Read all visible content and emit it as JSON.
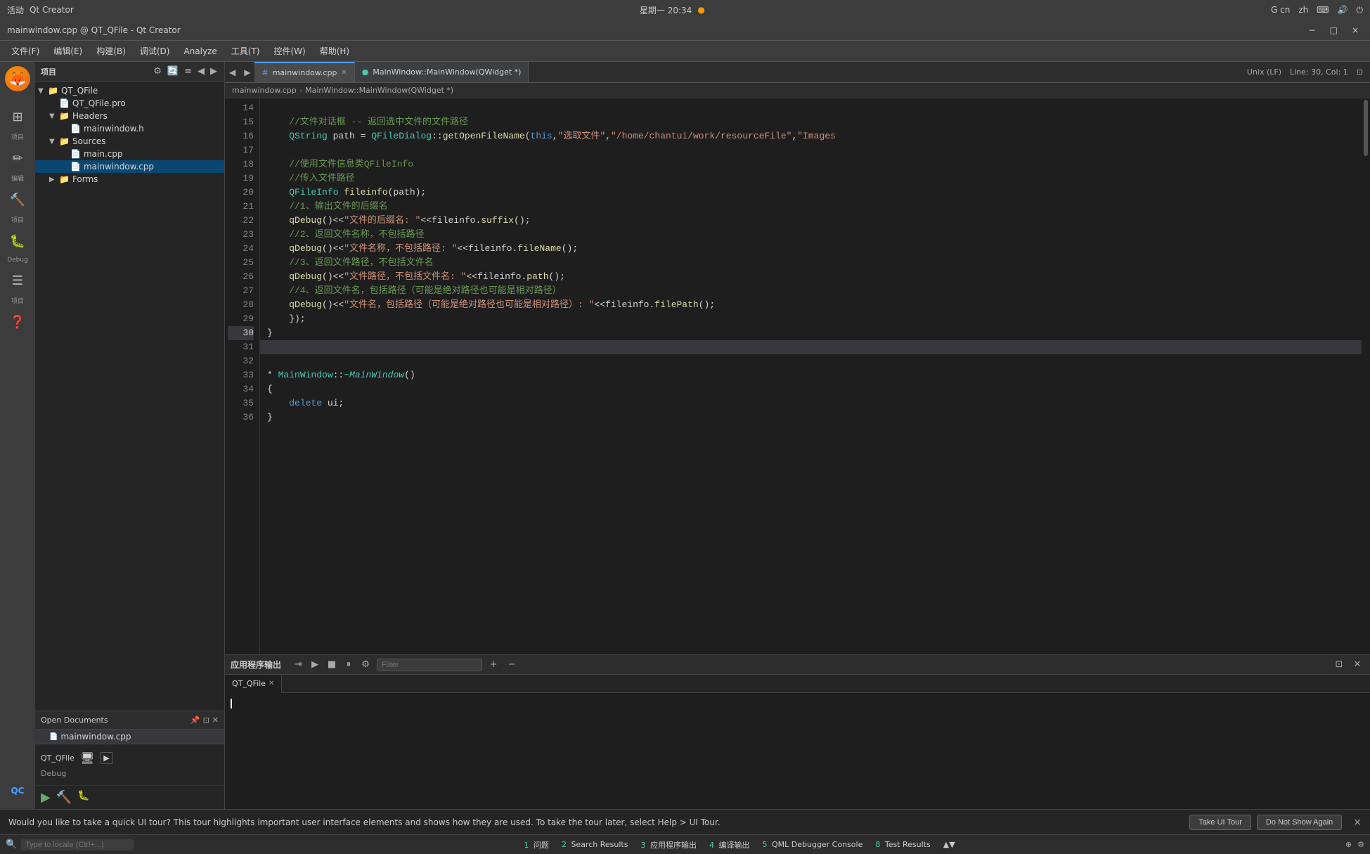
{
  "system_bar": {
    "activities": "活动",
    "app_name": "Qt Creator",
    "time": "星期一 20:34",
    "lang1": "G cn",
    "lang2": "zh"
  },
  "title_bar": {
    "title": "mainwindow.cpp @ QT_QFile - Qt Creator",
    "btn_min": "−",
    "btn_max": "□",
    "btn_close": "×"
  },
  "menu": {
    "items": [
      "文件(F)",
      "编辑(E)",
      "构建(B)",
      "调试(D)",
      "Analyze",
      "工具(T)",
      "控件(W)",
      "帮助(H)"
    ]
  },
  "tabs": {
    "items": [
      {
        "label": "mainwindow.cpp",
        "active": true,
        "icon": "#"
      },
      {
        "label": "MainWindow::MainWindow(QWidget *)",
        "active": false
      }
    ]
  },
  "breadcrumb": {
    "path": "mainwindow.cpp",
    "separator": ">",
    "func": "MainWindow::MainWindow(QWidget *)"
  },
  "status_bar": {
    "encoding": "Unix (LF)",
    "position": "Line: 30, Col: 1"
  },
  "sidebar": {
    "title": "项目",
    "icons": [
      "⚙",
      "🔍",
      "≡"
    ],
    "tree": [
      {
        "level": 0,
        "label": "QT_QFile",
        "expanded": true,
        "icon": "📁",
        "type": "folder"
      },
      {
        "level": 1,
        "label": "QT_QFile.pro",
        "expanded": false,
        "icon": "📄",
        "type": "file"
      },
      {
        "level": 1,
        "label": "Headers",
        "expanded": true,
        "icon": "📁",
        "type": "folder"
      },
      {
        "level": 2,
        "label": "mainwindow.h",
        "expanded": false,
        "icon": "📄",
        "type": "file"
      },
      {
        "level": 1,
        "label": "Sources",
        "expanded": true,
        "icon": "📁",
        "type": "folder"
      },
      {
        "level": 2,
        "label": "main.cpp",
        "expanded": false,
        "icon": "📄",
        "type": "file"
      },
      {
        "level": 2,
        "label": "mainwindow.cpp",
        "expanded": false,
        "icon": "📄",
        "type": "file",
        "selected": true
      },
      {
        "level": 1,
        "label": "Forms",
        "expanded": false,
        "icon": "📁",
        "type": "folder"
      }
    ]
  },
  "open_docs": {
    "title": "Open Documents",
    "items": [
      {
        "label": "mainwindow.cpp",
        "active": true
      }
    ]
  },
  "code": {
    "lines": [
      {
        "num": "14",
        "content": "    //文件对话框 -- 返回选中文件的文件路径",
        "type": "comment"
      },
      {
        "num": "15",
        "content": "    QString path = QFileDialog::getOpenFileName(this,\"选取文件\",\"/home/chantui/work/resourceFile\",\"Images",
        "type": "code"
      },
      {
        "num": "16",
        "content": "",
        "type": "empty"
      },
      {
        "num": "17",
        "content": "    //使用文件信息类QFileInfo",
        "type": "comment"
      },
      {
        "num": "18",
        "content": "    //传入文件路径",
        "type": "comment"
      },
      {
        "num": "19",
        "content": "    QFileInfo fileinfo(path);",
        "type": "code"
      },
      {
        "num": "20",
        "content": "    //1、输出文件的后缀名",
        "type": "comment"
      },
      {
        "num": "21",
        "content": "    qDebug()<<\"文件的后缀名: \"<<fileinfo.suffix();",
        "type": "code"
      },
      {
        "num": "22",
        "content": "    //2、返回文件名称，不包括路径",
        "type": "comment"
      },
      {
        "num": "23",
        "content": "    qDebug()<<\"文件名称，不包括路径: \"<<fileinfo.fileName();",
        "type": "code"
      },
      {
        "num": "24",
        "content": "    //3、返回文件路径，不包括文件名",
        "type": "comment"
      },
      {
        "num": "25",
        "content": "    qDebug()<<\"文件路径，不包括文件名: \"<<fileinfo.path();",
        "type": "code"
      },
      {
        "num": "26",
        "content": "    //4、返回文件名，包括路径（可能是绝对路径也可能是相对路径）",
        "type": "comment"
      },
      {
        "num": "27",
        "content": "    qDebug()<<\"文件名，包括路径（可能是绝对路径也可能是相对路径）: \"<<fileinfo.filePath();",
        "type": "code"
      },
      {
        "num": "28",
        "content": "    });",
        "type": "code"
      },
      {
        "num": "29",
        "content": "}",
        "type": "code"
      },
      {
        "num": "30",
        "content": "",
        "type": "empty"
      },
      {
        "num": "31",
        "content": "* MainWindow::~MainWindow()",
        "type": "code"
      },
      {
        "num": "32",
        "content": "{",
        "type": "code"
      },
      {
        "num": "33",
        "content": "    delete ui;",
        "type": "code"
      },
      {
        "num": "34",
        "content": "}",
        "type": "code"
      },
      {
        "num": "35",
        "content": "",
        "type": "empty"
      },
      {
        "num": "36",
        "content": "",
        "type": "empty"
      }
    ]
  },
  "output_panel": {
    "title": "应用程序输出",
    "filter_placeholder": "Filter",
    "tabs": [
      {
        "label": "QT_QFile",
        "active": true
      }
    ]
  },
  "notification": {
    "message": "Would you like to take a quick UI tour? This tour highlights important user interface elements and shows how they are used. To take the tour later, select Help > UI Tour.",
    "btn_take": "Take UI Tour",
    "btn_no_show": "Do Not Show Again",
    "close": "×"
  },
  "bottom_strip": {
    "search_placeholder": "Type to locate (Ctrl+...)",
    "tabs": [
      {
        "num": "1",
        "label": "问题"
      },
      {
        "num": "2",
        "label": "Search Results"
      },
      {
        "num": "3",
        "label": "应用程序输出"
      },
      {
        "num": "4",
        "label": "编译输出"
      },
      {
        "num": "5",
        "label": "QML Debugger Console"
      },
      {
        "num": "8",
        "label": "Test Results"
      }
    ],
    "arrows": "▲▼"
  },
  "activity_bar": {
    "items": [
      {
        "icon": "🦊",
        "label": "",
        "type": "firefox"
      },
      {
        "icon": "⊞",
        "label": "项目",
        "active": false
      },
      {
        "icon": "✏",
        "label": "编辑"
      },
      {
        "icon": "📦",
        "label": "项目"
      },
      {
        "icon": "🐛",
        "label": "Debug"
      },
      {
        "icon": "🔨",
        "label": "项目"
      },
      {
        "icon": "❓",
        "label": ""
      },
      {
        "icon": "QC",
        "label": ""
      }
    ]
  },
  "debug_sidebar": {
    "project": "QT_QFile",
    "mode": "Debug"
  },
  "colors": {
    "accent": "#007acc",
    "bg_dark": "#1e1e1e",
    "bg_panel": "#252526",
    "selected": "#094771"
  }
}
